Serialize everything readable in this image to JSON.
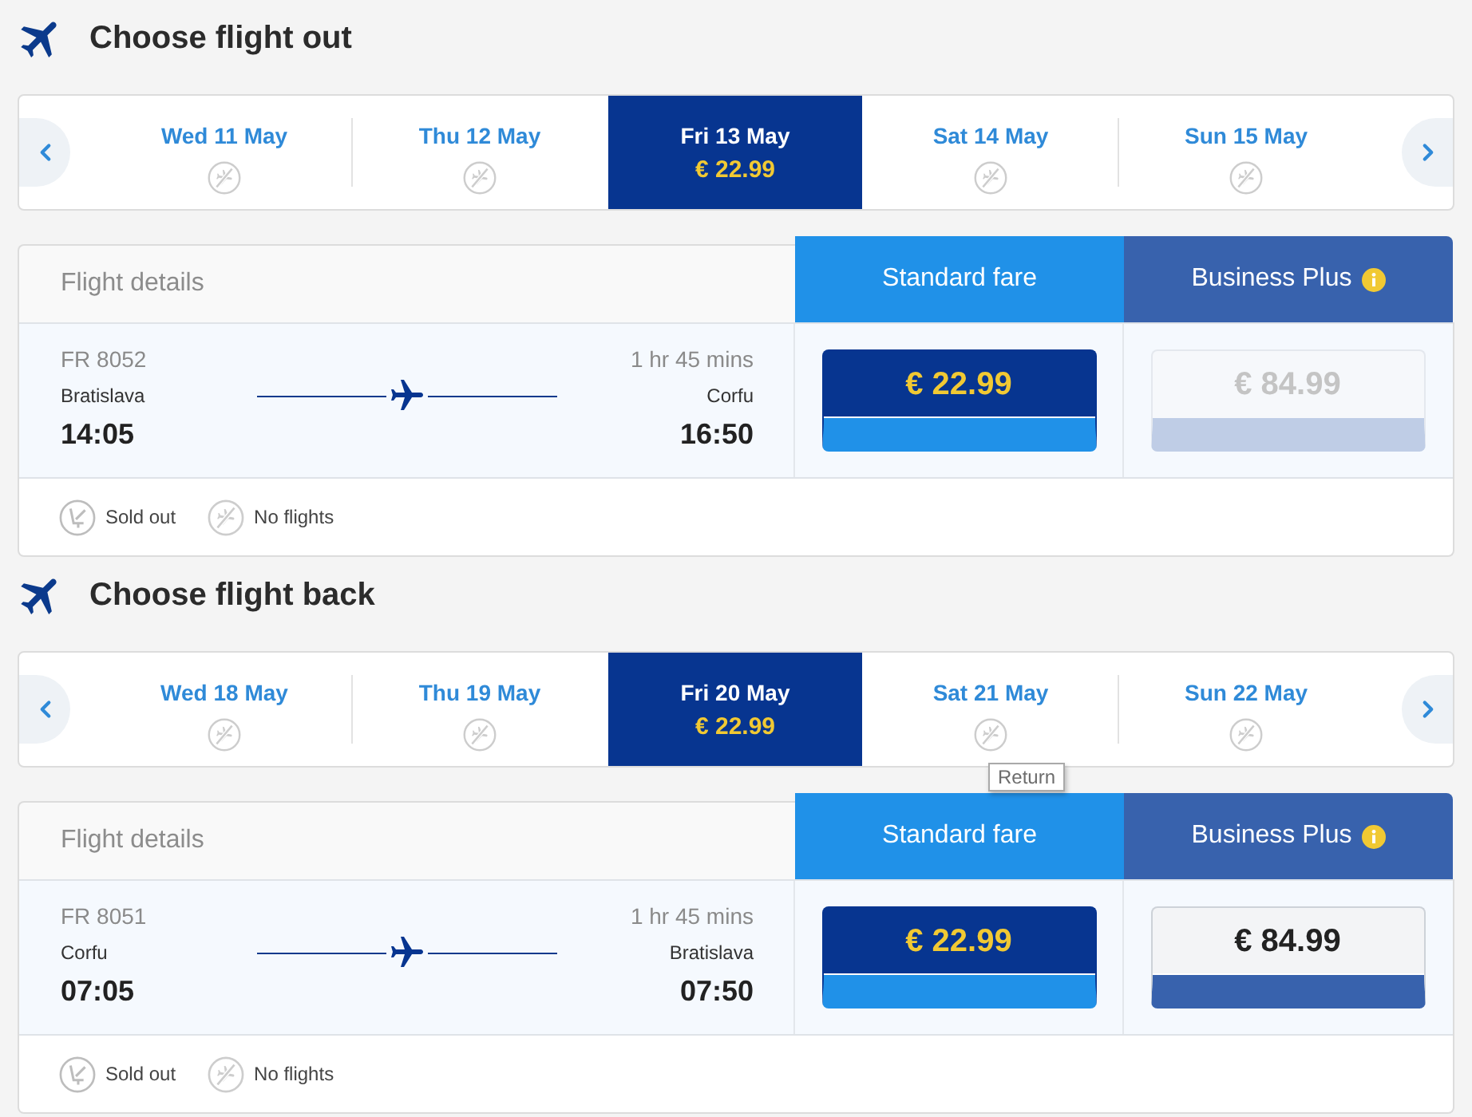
{
  "sections": [
    {
      "title": "Choose flight out",
      "dates": [
        {
          "label": "Wed 11 May",
          "selected": false,
          "kind": "no_flights"
        },
        {
          "label": "Thu 12 May",
          "selected": false,
          "kind": "no_flights"
        },
        {
          "label": "Fri 13 May",
          "selected": true,
          "kind": "fare",
          "price": "€ 22.99"
        },
        {
          "label": "Sat 14 May",
          "selected": false,
          "kind": "no_flights"
        },
        {
          "label": "Sun 15 May",
          "selected": false,
          "kind": "no_flights"
        }
      ],
      "details_heading": "Flight details",
      "fare_columns": [
        {
          "label": "Standard fare",
          "kind": "standard"
        },
        {
          "label": "Business Plus",
          "kind": "business"
        }
      ],
      "flight": {
        "number": "FR 8052",
        "duration": "1 hr 45 mins",
        "origin": "Bratislava",
        "destination": "Corfu",
        "departure": "14:05",
        "arrival": "16:50",
        "fares": [
          {
            "price": "€ 22.99",
            "selected": true,
            "disabled": false
          },
          {
            "price": "€ 84.99",
            "selected": false,
            "disabled": true
          }
        ]
      },
      "legend": [
        {
          "kind": "sold_out",
          "label": "Sold out"
        },
        {
          "kind": "no_flights",
          "label": "No flights"
        }
      ]
    },
    {
      "title": "Choose flight back",
      "dates": [
        {
          "label": "Wed 18 May",
          "selected": false,
          "kind": "no_flights"
        },
        {
          "label": "Thu 19 May",
          "selected": false,
          "kind": "no_flights"
        },
        {
          "label": "Fri 20 May",
          "selected": true,
          "kind": "fare",
          "price": "€ 22.99"
        },
        {
          "label": "Sat 21 May",
          "selected": false,
          "kind": "no_flights",
          "tooltip": "Return"
        },
        {
          "label": "Sun 22 May",
          "selected": false,
          "kind": "no_flights"
        }
      ],
      "details_heading": "Flight details",
      "fare_columns": [
        {
          "label": "Standard fare",
          "kind": "standard"
        },
        {
          "label": "Business Plus",
          "kind": "business"
        }
      ],
      "flight": {
        "number": "FR 8051",
        "duration": "1 hr 45 mins",
        "origin": "Corfu",
        "destination": "Bratislava",
        "departure": "07:05",
        "arrival": "07:50",
        "fares": [
          {
            "price": "€ 22.99",
            "selected": true,
            "disabled": false
          },
          {
            "price": "€ 84.99",
            "selected": false,
            "disabled": false
          }
        ]
      },
      "legend": [
        {
          "kind": "sold_out",
          "label": "Sold out"
        },
        {
          "kind": "no_flights",
          "label": "No flights"
        }
      ]
    }
  ]
}
